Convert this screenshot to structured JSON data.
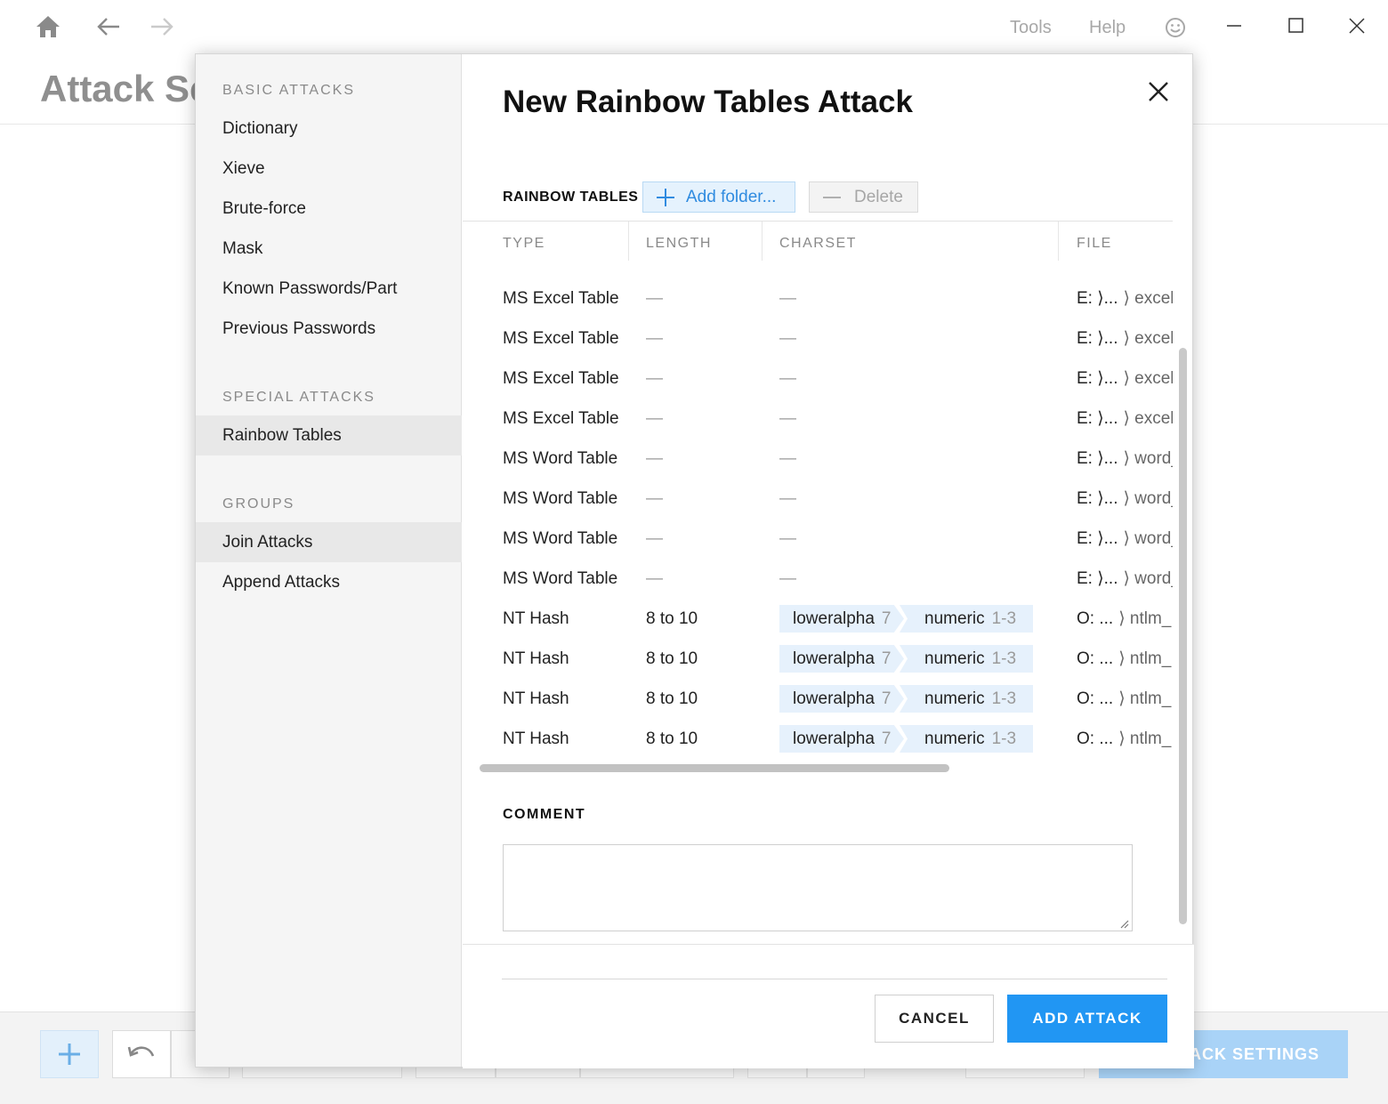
{
  "titlebar": {
    "menu_tools": "Tools",
    "menu_help": "Help"
  },
  "background": {
    "page_title": "Attack Se",
    "settings_button": "TACK SETTINGS"
  },
  "sidebar": {
    "basic_heading": "BASIC ATTACKS",
    "basic_items": [
      "Dictionary",
      "Xieve",
      "Brute-force",
      "Mask",
      "Known Passwords/Part",
      "Previous Passwords"
    ],
    "special_heading": "SPECIAL ATTACKS",
    "special_items": [
      "Rainbow Tables"
    ],
    "groups_heading": "GROUPS",
    "group_items": [
      "Join Attacks",
      "Append Attacks"
    ],
    "selected": "Rainbow Tables"
  },
  "dialog": {
    "title": "New Rainbow Tables Attack",
    "rainbow_tables_label": "RAINBOW TABLES",
    "add_folder_label": "Add folder...",
    "delete_label": "Delete",
    "columns": [
      "TYPE",
      "LENGTH",
      "CHARSET",
      "FILE"
    ],
    "rows": [
      {
        "type": "MS Excel Table",
        "length": "—",
        "charset": "—",
        "file_drive": "E: ⟩...",
        "file_name": "⟩ excel_"
      },
      {
        "type": "MS Excel Table",
        "length": "—",
        "charset": "—",
        "file_drive": "E: ⟩...",
        "file_name": "⟩ excel_"
      },
      {
        "type": "MS Excel Table",
        "length": "—",
        "charset": "—",
        "file_drive": "E: ⟩...",
        "file_name": "⟩ excel_"
      },
      {
        "type": "MS Excel Table",
        "length": "—",
        "charset": "—",
        "file_drive": "E: ⟩...",
        "file_name": "⟩ excel_"
      },
      {
        "type": "MS Word Table",
        "length": "—",
        "charset": "—",
        "file_drive": "E: ⟩...",
        "file_name": "⟩ word_"
      },
      {
        "type": "MS Word Table",
        "length": "—",
        "charset": "—",
        "file_drive": "E: ⟩...",
        "file_name": "⟩ word_"
      },
      {
        "type": "MS Word Table",
        "length": "—",
        "charset": "—",
        "file_drive": "E: ⟩...",
        "file_name": "⟩ word_"
      },
      {
        "type": "MS Word Table",
        "length": "—",
        "charset": "—",
        "file_drive": "E: ⟩...",
        "file_name": "⟩ word_"
      },
      {
        "type": "NT Hash",
        "length": "8 to 10",
        "charset_parts": [
          {
            "name": "loweralpha",
            "count": "7"
          },
          {
            "name": "numeric",
            "count": "1-3"
          }
        ],
        "file_drive": "O: ...",
        "file_name": "⟩ ntlm_"
      },
      {
        "type": "NT Hash",
        "length": "8 to 10",
        "charset_parts": [
          {
            "name": "loweralpha",
            "count": "7"
          },
          {
            "name": "numeric",
            "count": "1-3"
          }
        ],
        "file_drive": "O: ...",
        "file_name": "⟩ ntlm_"
      },
      {
        "type": "NT Hash",
        "length": "8 to 10",
        "charset_parts": [
          {
            "name": "loweralpha",
            "count": "7"
          },
          {
            "name": "numeric",
            "count": "1-3"
          }
        ],
        "file_drive": "O: ...",
        "file_name": "⟩ ntlm_"
      },
      {
        "type": "NT Hash",
        "length": "8 to 10",
        "charset_parts": [
          {
            "name": "loweralpha",
            "count": "7"
          },
          {
            "name": "numeric",
            "count": "1-3"
          }
        ],
        "file_drive": "O: ...",
        "file_name": "⟩ ntlm_"
      }
    ],
    "comment_label": "COMMENT",
    "comment_value": "",
    "cancel_label": "CANCEL",
    "add_attack_label": "ADD ATTACK"
  },
  "icons": {
    "home": "home-icon",
    "back": "arrow-left-icon",
    "forward": "arrow-right-icon",
    "smile": "smiley-icon",
    "minimize": "minimize-icon",
    "maximize": "maximize-icon",
    "close": "close-icon",
    "plus": "plus-icon",
    "minus": "minus-icon",
    "undo": "undo-icon"
  },
  "colors": {
    "accent": "#2196f3",
    "chip_bg": "#e6f1fc",
    "selected_bg": "#e8e8e8"
  }
}
